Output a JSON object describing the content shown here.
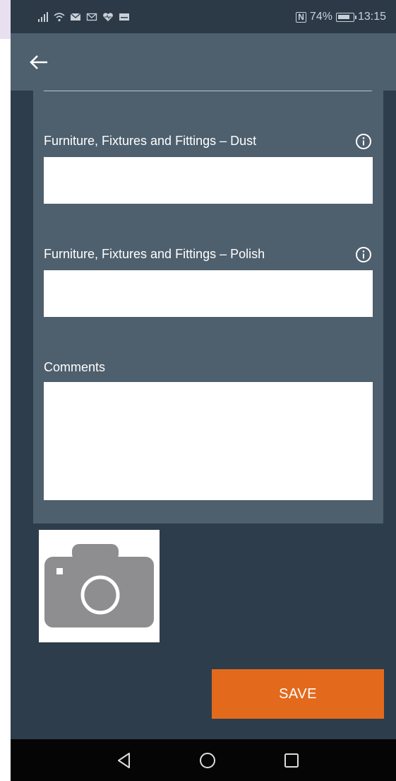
{
  "status_bar": {
    "nfc_label": "N",
    "battery_percent": "74%",
    "time": "13:15"
  },
  "app_bar": {
    "back_icon": "arrow-left-icon"
  },
  "form": {
    "fields": [
      {
        "label": "Furniture, Fixtures and Fittings – Dust",
        "value": "",
        "info_icon": "info-icon"
      },
      {
        "label": "Furniture, Fixtures and Fittings – Polish",
        "value": "",
        "info_icon": "info-icon"
      }
    ],
    "comments": {
      "label": "Comments",
      "value": ""
    }
  },
  "photo": {
    "icon": "camera-icon"
  },
  "actions": {
    "save_label": "SAVE"
  },
  "colors": {
    "background": "#2e3d4c",
    "panel": "#4e5f6d",
    "accent": "#e36a1c"
  },
  "nav_bar": {
    "back": "triangle-back-icon",
    "home": "circle-home-icon",
    "recents": "square-recents-icon"
  }
}
